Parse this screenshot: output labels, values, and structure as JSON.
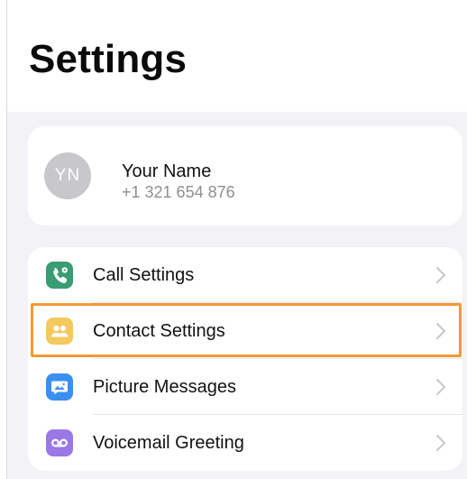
{
  "header": {
    "title": "Settings"
  },
  "profile": {
    "initials": "YN",
    "name": "Your Name",
    "phone": "+1 321 654 876"
  },
  "settings": {
    "items": [
      {
        "label": "Call Settings",
        "icon": "call-settings-icon",
        "color": "#3a9c73"
      },
      {
        "label": "Contact Settings",
        "icon": "contacts-icon",
        "color": "#f4c95d"
      },
      {
        "label": "Picture Messages",
        "icon": "picture-message-icon",
        "color": "#3a8ff0"
      },
      {
        "label": "Voicemail Greeting",
        "icon": "voicemail-icon",
        "color": "#9a78e6"
      }
    ],
    "selected_item": "Contact Settings"
  },
  "colors": {
    "highlight": "#f29a33",
    "background": "#f2f2f7",
    "secondary_text": "#8e8e93"
  }
}
